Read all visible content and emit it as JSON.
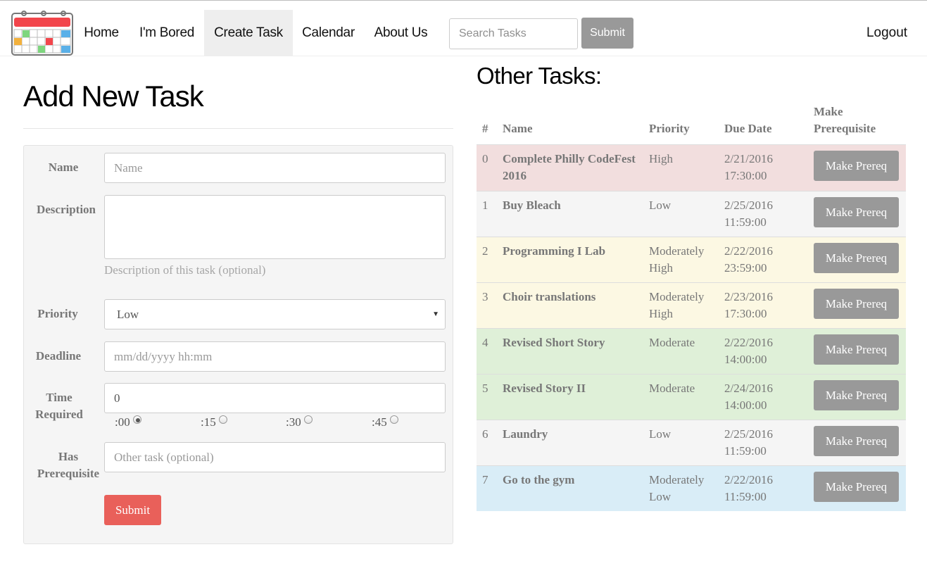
{
  "nav": {
    "links": [
      "Home",
      "I'm Bored",
      "Create Task",
      "Calendar",
      "About Us"
    ],
    "search_placeholder": "Search Tasks",
    "search_button": "Submit",
    "logout": "Logout"
  },
  "form": {
    "title": "Add New Task",
    "name_label": "Name",
    "name_placeholder": "Name",
    "description_label": "Description",
    "description_help": "Description of this task (optional)",
    "priority_label": "Priority",
    "priority_value": "Low",
    "deadline_label": "Deadline",
    "deadline_placeholder": "mm/dd/yyyy hh:mm",
    "time_label_1": "Time",
    "time_label_2": "Required",
    "time_value": "0",
    "time_options": [
      ":00",
      ":15",
      ":30",
      ":45"
    ],
    "time_selected": ":00",
    "prereq_label_1": "Has",
    "prereq_label_2": "Prerequisite",
    "prereq_placeholder": "Other task (optional)",
    "submit": "Submit"
  },
  "tasks": {
    "title": "Other Tasks:",
    "headers": {
      "num": "#",
      "name": "Name",
      "priority": "Priority",
      "due": "Due Date",
      "prereq_1": "Make",
      "prereq_2": "Prerequisite"
    },
    "button_label": "Make Prereq",
    "rows": [
      {
        "num": "0",
        "name": "Complete Philly CodeFest 2016",
        "priority": "High",
        "date": "2/21/2016",
        "time": "17:30:00",
        "color": "#f2dede"
      },
      {
        "num": "1",
        "name": "Buy Bleach",
        "priority": "Low",
        "date": "2/25/2016",
        "time": "11:59:00",
        "color": "#f5f5f5"
      },
      {
        "num": "2",
        "name": "Programming I Lab",
        "priority": "Moderately High",
        "date": "2/22/2016",
        "time": "23:59:00",
        "color": "#fcf8e3"
      },
      {
        "num": "3",
        "name": "Choir translations",
        "priority": "Moderately High",
        "date": "2/23/2016",
        "time": "17:30:00",
        "color": "#fcf8e3"
      },
      {
        "num": "4",
        "name": "Revised Short Story",
        "priority": "Moderate",
        "date": "2/22/2016",
        "time": "14:00:00",
        "color": "#dff0d8"
      },
      {
        "num": "5",
        "name": "Revised Story II",
        "priority": "Moderate",
        "date": "2/24/2016",
        "time": "14:00:00",
        "color": "#dff0d8"
      },
      {
        "num": "6",
        "name": "Laundry",
        "priority": "Low",
        "date": "2/25/2016",
        "time": "11:59:00",
        "color": "#f5f5f5"
      },
      {
        "num": "7",
        "name": "Go to the gym",
        "priority": "Moderately Low",
        "date": "2/22/2016",
        "time": "11:59:00",
        "color": "#d9edf7"
      }
    ]
  }
}
